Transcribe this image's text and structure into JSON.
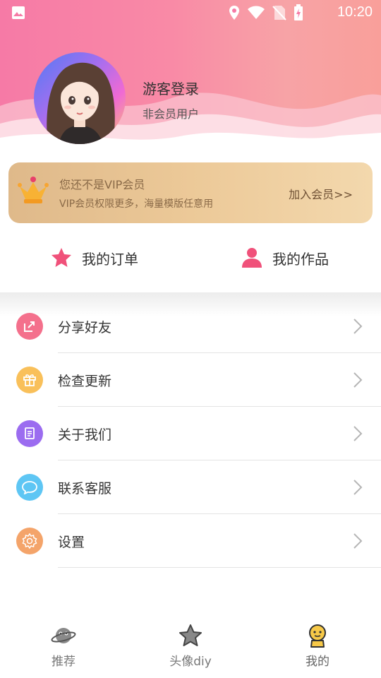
{
  "status_bar": {
    "time": "10:20"
  },
  "profile": {
    "name": "游客登录",
    "level": "非会员用户"
  },
  "vip": {
    "title": "您还不是VIP会员",
    "subtitle": "VIP会员权限更多，海量模版任意用",
    "join_label": "加入会员>>"
  },
  "quick_actions": [
    {
      "label": "我的订单",
      "icon": "star-icon"
    },
    {
      "label": "我的作品",
      "icon": "person-icon"
    }
  ],
  "menu": [
    {
      "label": "分享好友",
      "icon": "share-icon",
      "color": "#f4708c"
    },
    {
      "label": "检查更新",
      "icon": "gift-icon",
      "color": "#f9c05a"
    },
    {
      "label": "关于我们",
      "icon": "document-icon",
      "color": "#9b6cf0"
    },
    {
      "label": "联系客服",
      "icon": "chat-icon",
      "color": "#5ec6f4"
    },
    {
      "label": "设置",
      "icon": "gear-icon",
      "color": "#f4a46a"
    }
  ],
  "bottom_nav": [
    {
      "label": "推荐",
      "icon": "planet-icon"
    },
    {
      "label": "头像diy",
      "icon": "star-outline-icon"
    },
    {
      "label": "我的",
      "icon": "emoji-face-icon",
      "active": true
    }
  ]
}
